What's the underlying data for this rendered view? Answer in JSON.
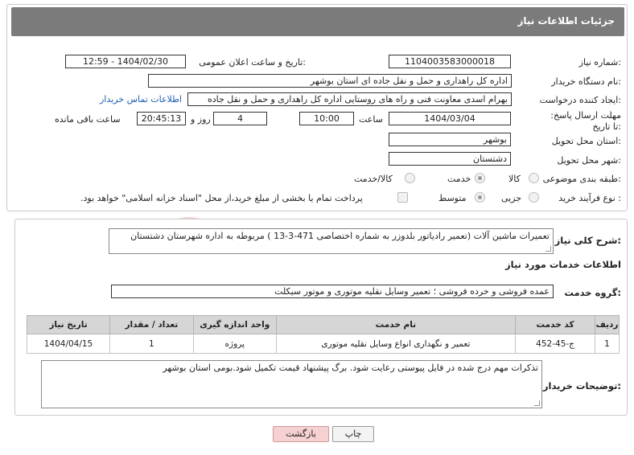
{
  "header": {
    "title": "جزئیات اطلاعات نیاز"
  },
  "fields": {
    "need_number_label": "شماره نیاز:",
    "need_number": "1104003583000018",
    "announce_label": "تاریخ و ساعت اعلان عمومی:",
    "announce_value": "1404/02/30 - 12:59",
    "buyer_org_label": "نام دستگاه خریدار:",
    "buyer_org": "اداره کل راهداری و حمل و نقل جاده ای استان بوشهر",
    "creator_label": "ایجاد کننده درخواست:",
    "creator": "بهرام اسدی معاونت فنی و راه های روستایی اداره کل راهداری و حمل و نقل جاده",
    "contact_link": "اطلاعات تماس خریدار",
    "deadline_label": "مهلت ارسال پاسخ: تا تاریخ:",
    "deadline_date": "1404/03/04",
    "time_label": "ساعت",
    "deadline_time": "10:00",
    "days_value": "4",
    "days_label": "روز و",
    "remaining_time": "20:45:13",
    "remaining_label": "ساعت باقی مانده",
    "province_label": "استان محل تحویل:",
    "province": "بوشهر",
    "city_label": "شهر محل تحویل:",
    "city": "دشتستان",
    "category_label": "طبقه بندی موضوعی:",
    "category_options": [
      "کالا",
      "خدمت",
      "کالا/خدمت"
    ],
    "category_selected": "خدمت",
    "process_label": "نوع فرآیند خرید :",
    "process_options": [
      "جزیی",
      "متوسط"
    ],
    "process_selected": "متوسط",
    "payment_note": "پرداخت تمام یا بخشی از مبلغ خرید،از محل \"اسناد خزانه اسلامی\" خواهد بود."
  },
  "details": {
    "summary_label": "شرح کلی نیاز:",
    "summary": "تعمیرات ماشین آلات (تعمیر رادیاتور بلدوزر به شماره اختصاصی 471-3-13 ) مربوطه به اداره شهرستان دشتستان",
    "services_heading": "اطلاعات خدمات مورد نیاز",
    "service_group_label": "گروه خدمت:",
    "service_group": "عمده فروشی و خرده فروشی ؛ تعمیر وسایل نقلیه موتوری و موتور سیکلت",
    "table": {
      "headers": [
        "ردیف",
        "کد خدمت",
        "نام خدمت",
        "واحد اندازه گیری",
        "تعداد / مقدار",
        "تاریخ نیاز"
      ],
      "rows": [
        [
          "1",
          "ج-45-452",
          "تعمیر و نگهداری انواع وسایل نقلیه موتوری",
          "پروژه",
          "1",
          "1404/04/15"
        ]
      ]
    },
    "buyer_notes_label": "توضیحات خریدار:",
    "buyer_notes": "تذکرات مهم درج شده در فایل پیوستی رعایت شود. برگ پیشنهاد قیمت تکمیل شود.بومی استان بوشهر"
  },
  "buttons": {
    "print": "چاپ",
    "back": "بازگشت"
  },
  "watermark": {
    "text": "AriaTender.neT"
  },
  "colors": {
    "header_bg": "#7b7b7b",
    "link": "#1a5fb4",
    "back_btn_bg": "#f6d1d1",
    "print_btn_bg": "#f3f3f3",
    "watermark": "#f1cfcf"
  }
}
